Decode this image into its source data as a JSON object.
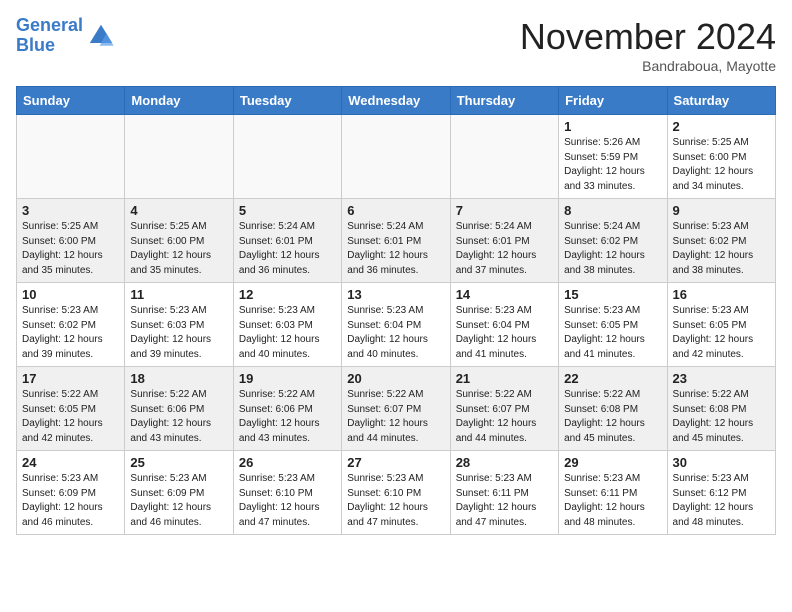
{
  "header": {
    "logo_line1": "General",
    "logo_line2": "Blue",
    "month": "November 2024",
    "location": "Bandraboua, Mayotte"
  },
  "columns": [
    "Sunday",
    "Monday",
    "Tuesday",
    "Wednesday",
    "Thursday",
    "Friday",
    "Saturday"
  ],
  "weeks": [
    [
      {
        "day": "",
        "info": ""
      },
      {
        "day": "",
        "info": ""
      },
      {
        "day": "",
        "info": ""
      },
      {
        "day": "",
        "info": ""
      },
      {
        "day": "",
        "info": ""
      },
      {
        "day": "1",
        "info": "Sunrise: 5:26 AM\nSunset: 5:59 PM\nDaylight: 12 hours\nand 33 minutes."
      },
      {
        "day": "2",
        "info": "Sunrise: 5:25 AM\nSunset: 6:00 PM\nDaylight: 12 hours\nand 34 minutes."
      }
    ],
    [
      {
        "day": "3",
        "info": "Sunrise: 5:25 AM\nSunset: 6:00 PM\nDaylight: 12 hours\nand 35 minutes."
      },
      {
        "day": "4",
        "info": "Sunrise: 5:25 AM\nSunset: 6:00 PM\nDaylight: 12 hours\nand 35 minutes."
      },
      {
        "day": "5",
        "info": "Sunrise: 5:24 AM\nSunset: 6:01 PM\nDaylight: 12 hours\nand 36 minutes."
      },
      {
        "day": "6",
        "info": "Sunrise: 5:24 AM\nSunset: 6:01 PM\nDaylight: 12 hours\nand 36 minutes."
      },
      {
        "day": "7",
        "info": "Sunrise: 5:24 AM\nSunset: 6:01 PM\nDaylight: 12 hours\nand 37 minutes."
      },
      {
        "day": "8",
        "info": "Sunrise: 5:24 AM\nSunset: 6:02 PM\nDaylight: 12 hours\nand 38 minutes."
      },
      {
        "day": "9",
        "info": "Sunrise: 5:23 AM\nSunset: 6:02 PM\nDaylight: 12 hours\nand 38 minutes."
      }
    ],
    [
      {
        "day": "10",
        "info": "Sunrise: 5:23 AM\nSunset: 6:02 PM\nDaylight: 12 hours\nand 39 minutes."
      },
      {
        "day": "11",
        "info": "Sunrise: 5:23 AM\nSunset: 6:03 PM\nDaylight: 12 hours\nand 39 minutes."
      },
      {
        "day": "12",
        "info": "Sunrise: 5:23 AM\nSunset: 6:03 PM\nDaylight: 12 hours\nand 40 minutes."
      },
      {
        "day": "13",
        "info": "Sunrise: 5:23 AM\nSunset: 6:04 PM\nDaylight: 12 hours\nand 40 minutes."
      },
      {
        "day": "14",
        "info": "Sunrise: 5:23 AM\nSunset: 6:04 PM\nDaylight: 12 hours\nand 41 minutes."
      },
      {
        "day": "15",
        "info": "Sunrise: 5:23 AM\nSunset: 6:05 PM\nDaylight: 12 hours\nand 41 minutes."
      },
      {
        "day": "16",
        "info": "Sunrise: 5:23 AM\nSunset: 6:05 PM\nDaylight: 12 hours\nand 42 minutes."
      }
    ],
    [
      {
        "day": "17",
        "info": "Sunrise: 5:22 AM\nSunset: 6:05 PM\nDaylight: 12 hours\nand 42 minutes."
      },
      {
        "day": "18",
        "info": "Sunrise: 5:22 AM\nSunset: 6:06 PM\nDaylight: 12 hours\nand 43 minutes."
      },
      {
        "day": "19",
        "info": "Sunrise: 5:22 AM\nSunset: 6:06 PM\nDaylight: 12 hours\nand 43 minutes."
      },
      {
        "day": "20",
        "info": "Sunrise: 5:22 AM\nSunset: 6:07 PM\nDaylight: 12 hours\nand 44 minutes."
      },
      {
        "day": "21",
        "info": "Sunrise: 5:22 AM\nSunset: 6:07 PM\nDaylight: 12 hours\nand 44 minutes."
      },
      {
        "day": "22",
        "info": "Sunrise: 5:22 AM\nSunset: 6:08 PM\nDaylight: 12 hours\nand 45 minutes."
      },
      {
        "day": "23",
        "info": "Sunrise: 5:22 AM\nSunset: 6:08 PM\nDaylight: 12 hours\nand 45 minutes."
      }
    ],
    [
      {
        "day": "24",
        "info": "Sunrise: 5:23 AM\nSunset: 6:09 PM\nDaylight: 12 hours\nand 46 minutes."
      },
      {
        "day": "25",
        "info": "Sunrise: 5:23 AM\nSunset: 6:09 PM\nDaylight: 12 hours\nand 46 minutes."
      },
      {
        "day": "26",
        "info": "Sunrise: 5:23 AM\nSunset: 6:10 PM\nDaylight: 12 hours\nand 47 minutes."
      },
      {
        "day": "27",
        "info": "Sunrise: 5:23 AM\nSunset: 6:10 PM\nDaylight: 12 hours\nand 47 minutes."
      },
      {
        "day": "28",
        "info": "Sunrise: 5:23 AM\nSunset: 6:11 PM\nDaylight: 12 hours\nand 47 minutes."
      },
      {
        "day": "29",
        "info": "Sunrise: 5:23 AM\nSunset: 6:11 PM\nDaylight: 12 hours\nand 48 minutes."
      },
      {
        "day": "30",
        "info": "Sunrise: 5:23 AM\nSunset: 6:12 PM\nDaylight: 12 hours\nand 48 minutes."
      }
    ]
  ]
}
